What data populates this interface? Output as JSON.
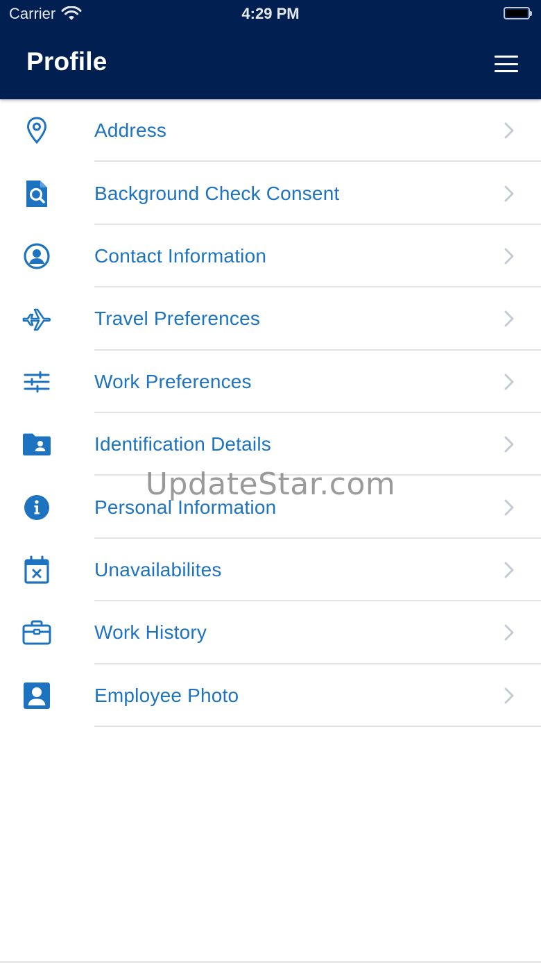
{
  "status_bar": {
    "carrier": "Carrier",
    "time": "4:29 PM"
  },
  "header": {
    "title": "Profile",
    "menu_icon": "hamburger-icon"
  },
  "colors": {
    "header_bg": "#021f52",
    "accent": "#1d73c0",
    "divider": "#e3e3e3"
  },
  "items": [
    {
      "label": "Address",
      "icon": "location-pin-icon"
    },
    {
      "label": "Background Check Consent",
      "icon": "document-search-icon"
    },
    {
      "label": "Contact Information",
      "icon": "user-circle-icon"
    },
    {
      "label": "Travel Preferences",
      "icon": "airplane-icon"
    },
    {
      "label": "Work Preferences",
      "icon": "sliders-icon"
    },
    {
      "label": "Identification Details",
      "icon": "folder-user-icon"
    },
    {
      "label": "Personal Information",
      "icon": "info-circle-icon"
    },
    {
      "label": "Unavailabilites",
      "icon": "calendar-x-icon"
    },
    {
      "label": "Work History",
      "icon": "briefcase-icon"
    },
    {
      "label": "Employee Photo",
      "icon": "id-photo-icon"
    }
  ],
  "watermark": "UpdateStar.com"
}
